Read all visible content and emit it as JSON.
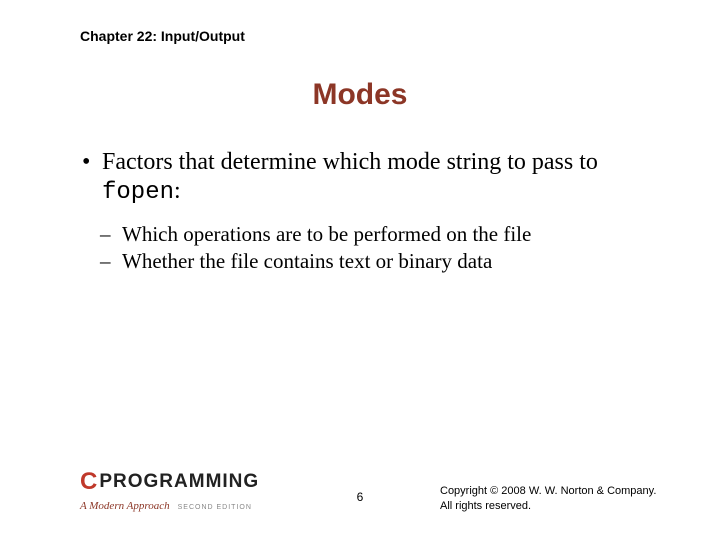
{
  "chapter": "Chapter 22: Input/Output",
  "title": "Modes",
  "bullet1_pre": "Factors that determine which mode string to pass to ",
  "bullet1_code": "fopen",
  "bullet1_post": ":",
  "sub1": "Which operations are to be performed on the file",
  "sub2": "Whether the file contains text or binary data",
  "page_number": "6",
  "copyright_line1": "Copyright © 2008 W. W. Norton & Company.",
  "copyright_line2": "All rights reserved.",
  "logo": {
    "c": "C",
    "prog": "PROGRAMMING",
    "sub": "A Modern Approach",
    "ed": "SECOND EDITION"
  }
}
